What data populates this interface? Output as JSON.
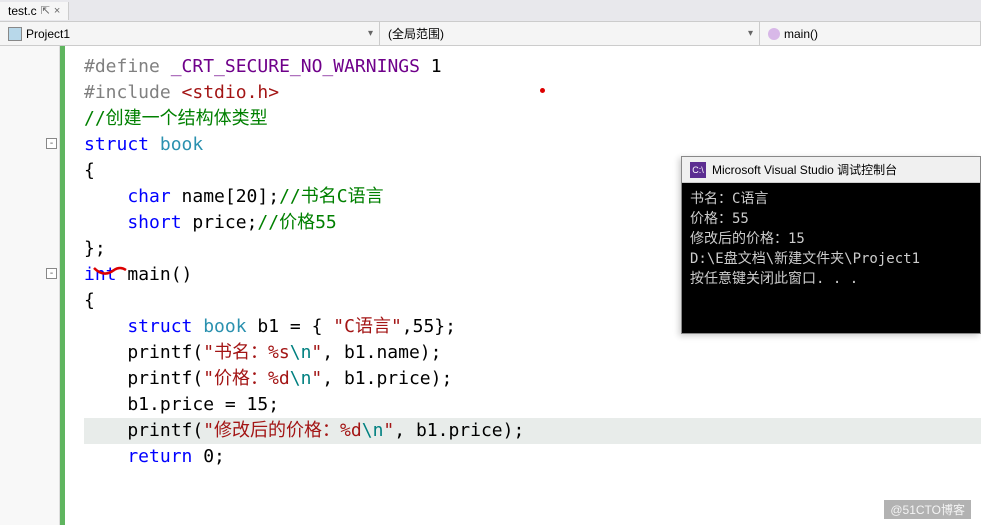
{
  "fileTab": {
    "name": "test.c",
    "pinGlyph": "⇱",
    "closeGlyph": "×"
  },
  "nav": {
    "project": "Project1",
    "scope": "(全局范围)",
    "member": "main()"
  },
  "outline": {
    "glyph1": "-",
    "glyph2": "-"
  },
  "code": {
    "l1a": "#define ",
    "l1b": "_CRT_SECURE_NO_WARNINGS",
    "l1c": " 1",
    "l2a": "#include ",
    "l2b": "<stdio.h>",
    "l3": "//创建一个结构体类型",
    "l4a": "struct",
    "l4b": " book",
    "l5": "{",
    "l6a": "    char",
    "l6b": " name[20];",
    "l6c": "//书名C语言",
    "l7a": "    short",
    "l7b": " price;",
    "l7c": "//价格55",
    "l8": "};",
    "l9a": "int",
    "l9b": " main()",
    "l10": "{",
    "l11a": "    struct",
    "l11b": " book",
    "l11c": " b1 = { ",
    "l11d": "\"C语言\"",
    "l11e": ",55};",
    "l12a": "    printf(",
    "l12b": "\"书名：%s",
    "l12c": "\\n",
    "l12d": "\"",
    "l12e": ", b1.name);",
    "l13a": "    printf(",
    "l13b": "\"价格：%d",
    "l13c": "\\n",
    "l13d": "\"",
    "l13e": ", b1.price);",
    "l14": "    b1.price = 15;",
    "l15a": "    printf(",
    "l15b": "\"修改后的价格：%d",
    "l15c": "\\n",
    "l15d": "\"",
    "l15e": ", b1.price);",
    "l16a": "    return",
    "l16b": " 0;"
  },
  "console": {
    "title": "Microsoft Visual Studio 调试控制台",
    "iconText": "C:\\",
    "line1": "书名：C语言",
    "line2": "价格：55",
    "line3": "修改后的价格：15",
    "blank": "",
    "line4": "D:\\E盘文档\\新建文件夹\\Project1",
    "line5": "按任意键关闭此窗口. . ."
  },
  "watermark": "@51CTO博客"
}
